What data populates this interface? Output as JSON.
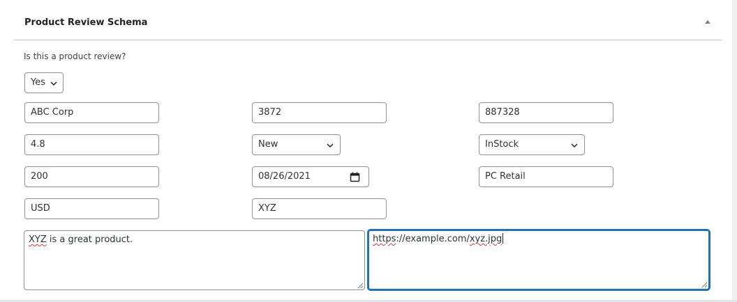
{
  "panel": {
    "title": "Product Review Schema",
    "toggle_icon": "triangle-up-icon"
  },
  "question": {
    "label": "Is this a product review?",
    "answer": "Yes"
  },
  "fields": {
    "brand": "ABC Corp",
    "sku": "3872",
    "gtin": "887328",
    "rating": "4.8",
    "condition": "New",
    "availability": "InStock",
    "price": "200",
    "date": "08/26/2021",
    "seller": "PC Retail",
    "currency": "USD",
    "product_name": "XYZ"
  },
  "review": {
    "word": "XYZ",
    "rest": " is a great product."
  },
  "image_url": {
    "p1": "https",
    "p2": "://example.com/",
    "p3": "xyz.jpg"
  },
  "colors": {
    "focus": "#2271b1",
    "border": "#8c8f94",
    "spellcheck": "#d63638"
  }
}
